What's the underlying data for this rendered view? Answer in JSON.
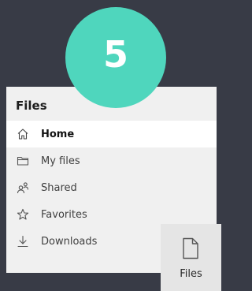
{
  "step": {
    "number": "5",
    "color": "#4fd6bd"
  },
  "panel": {
    "title": "Files",
    "items": [
      {
        "label": "Home",
        "icon": "home-icon",
        "selected": true
      },
      {
        "label": "My files",
        "icon": "folder-icon",
        "selected": false
      },
      {
        "label": "Shared",
        "icon": "people-icon",
        "selected": false
      },
      {
        "label": "Favorites",
        "icon": "star-icon",
        "selected": false
      },
      {
        "label": "Downloads",
        "icon": "download-icon",
        "selected": false
      }
    ]
  },
  "tile": {
    "label": "Files",
    "icon": "document-icon"
  },
  "colors": {
    "background": "#383b46",
    "panel": "#f0f0f0",
    "selected_row": "#ffffff",
    "tile": "#e5e5e5"
  }
}
